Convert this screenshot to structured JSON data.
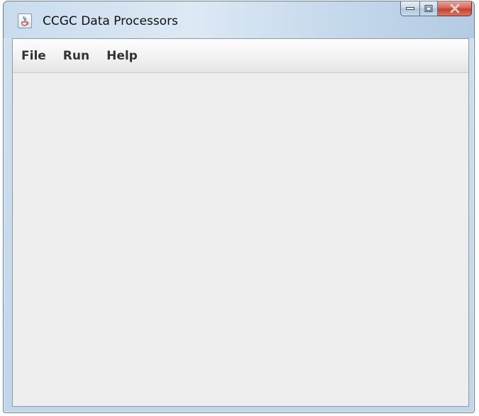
{
  "window": {
    "title": "CCGC Data Processors",
    "icon": "java-cup-icon"
  },
  "caption_buttons": {
    "minimize_icon": "minimize-icon",
    "maximize_icon": "maximize-icon",
    "close_icon": "close-icon",
    "close_color": "#c7402c"
  },
  "menubar": {
    "items": [
      {
        "label": "File"
      },
      {
        "label": "Run"
      },
      {
        "label": "Help"
      }
    ]
  },
  "colors": {
    "frame": "#c2d6ea",
    "client_background": "#eeeeee"
  }
}
